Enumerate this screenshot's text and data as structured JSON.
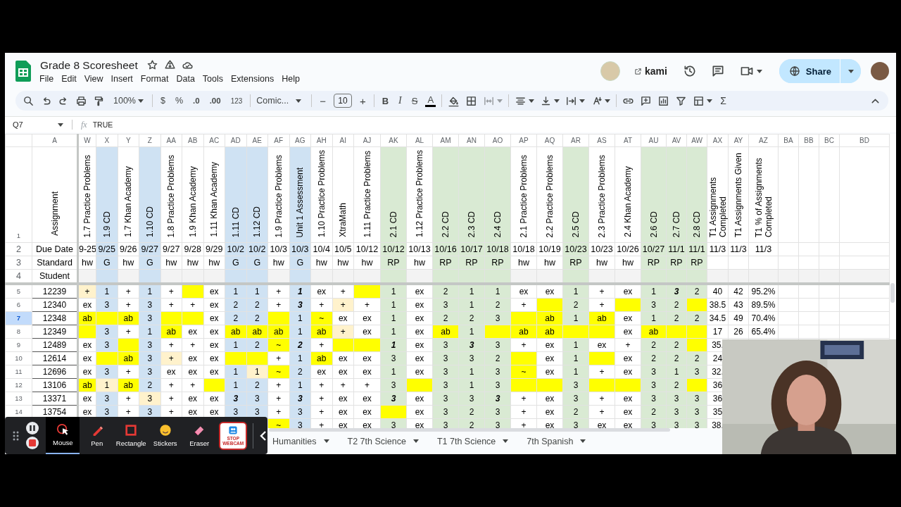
{
  "app": {
    "title": "Grade 8 Scoresheet",
    "menu": [
      "File",
      "Edit",
      "View",
      "Insert",
      "Format",
      "Data",
      "Tools",
      "Extensions",
      "Help"
    ],
    "addon": "kami",
    "share": "Share"
  },
  "toolbar": {
    "zoom": "100%",
    "currency": "$",
    "percent": "%",
    "decrease_decimal": ".0",
    "increase_decimal": ".00",
    "number_format": "123",
    "font": "Comic...",
    "minus": "−",
    "font_size": "10",
    "plus": "+",
    "bold": "B",
    "italic": "I",
    "strikethrough": "S",
    "text_color": "A",
    "sum": "Σ"
  },
  "formula_bar": {
    "cell": "Q7",
    "fx": "fx",
    "value": "TRUE"
  },
  "sheet": {
    "label_column": {
      "letter": "A",
      "title": "Assignment",
      "due": "Due Date",
      "standard": "Standard",
      "student": "Student"
    },
    "header_row_numbers": [
      "1",
      "2",
      "3",
      "4"
    ],
    "columns": [
      {
        "letter": "W",
        "title": "1.7 Practice Problems",
        "due": "9-25",
        "standard": "hw"
      },
      {
        "letter": "X",
        "title": "1.9 CD",
        "due": "9/25",
        "standard": "G",
        "color": "#cfe2f3"
      },
      {
        "letter": "Y",
        "title": "1.7 Khan Academy",
        "due": "9/26",
        "standard": "hw"
      },
      {
        "letter": "Z",
        "title": "1.10 CD",
        "due": "9/27",
        "standard": "G",
        "color": "#cfe2f3"
      },
      {
        "letter": "AA",
        "title": "1.8 Practice Problems",
        "due": "9/27",
        "standard": "hw"
      },
      {
        "letter": "AB",
        "title": "1.9 Khan Academy",
        "due": "9/28",
        "standard": "hw"
      },
      {
        "letter": "AC",
        "title": "1.11 Khan Academy",
        "due": "9/29",
        "standard": "hw"
      },
      {
        "letter": "AD",
        "title": "1.11 CD",
        "due": "10/2",
        "standard": "G",
        "color": "#cfe2f3"
      },
      {
        "letter": "AE",
        "title": "1.12 CD",
        "due": "10/2",
        "standard": "G",
        "color": "#cfe2f3"
      },
      {
        "letter": "AF",
        "title": "1.9 Practice Problems",
        "due": "10/3",
        "standard": "hw"
      },
      {
        "letter": "AG",
        "title": "Unit 1 Assessment",
        "due": "10/3",
        "standard": "G",
        "color": "#cfe2f3"
      },
      {
        "letter": "AH",
        "title": "1.10 Practice Problems",
        "due": "10/4",
        "standard": "hw"
      },
      {
        "letter": "AI",
        "title": "XtraMath",
        "due": "10/5",
        "standard": "hw"
      },
      {
        "letter": "AJ",
        "title": "1.11 Practice Problems",
        "due": "10/12",
        "standard": "hw"
      },
      {
        "letter": "AK",
        "title": "2.1 CD",
        "due": "10/12",
        "standard": "RP",
        "color": "#d9ead3"
      },
      {
        "letter": "AL",
        "title": "1.12 Practice Problems",
        "due": "10/13",
        "standard": "hw"
      },
      {
        "letter": "AM",
        "title": "2.2 CD",
        "due": "10/16",
        "standard": "RP",
        "color": "#d9ead3"
      },
      {
        "letter": "AN",
        "title": "2.3 CD",
        "due": "10/17",
        "standard": "RP",
        "color": "#d9ead3"
      },
      {
        "letter": "AO",
        "title": "2.4 CD",
        "due": "10/18",
        "standard": "RP",
        "color": "#d9ead3"
      },
      {
        "letter": "AP",
        "title": "2.1 Practice Problems",
        "due": "10/18",
        "standard": "hw"
      },
      {
        "letter": "AQ",
        "title": "2.2 Practice Problems",
        "due": "10/19",
        "standard": "hw"
      },
      {
        "letter": "AR",
        "title": "2.5 CD",
        "due": "10/23",
        "standard": "RP",
        "color": "#d9ead3"
      },
      {
        "letter": "AS",
        "title": "2.3 Practice Problems",
        "due": "10/23",
        "standard": "hw"
      },
      {
        "letter": "AT",
        "title": "2.4 Khan Academy",
        "due": "10/26",
        "standard": "hw"
      },
      {
        "letter": "AU",
        "title": "2.6 CD",
        "due": "10/27",
        "standard": "RP",
        "color": "#d9ead3"
      },
      {
        "letter": "AV",
        "title": "2.7 CD",
        "due": "11/1",
        "standard": "RP",
        "color": "#d9ead3"
      },
      {
        "letter": "AW",
        "title": "2.8 CD",
        "due": "11/1",
        "standard": "RP",
        "color": "#d9ead3"
      },
      {
        "letter": "AX",
        "title": "T1 Assignments Completed",
        "due": "11/3"
      },
      {
        "letter": "AY",
        "title": "T1 Assignments Given",
        "due": "11/3"
      },
      {
        "letter": "AZ",
        "title": "T1 % of Assignments Completed",
        "due": "11/3"
      },
      {
        "letter": "BA"
      },
      {
        "letter": "BB"
      },
      {
        "letter": "BC"
      },
      {
        "letter": "BD"
      }
    ],
    "rows": [
      {
        "number": "5",
        "student": "12239",
        "selected": false,
        "cells": [
          {
            "text": "+",
            "color": "#fff2cc"
          },
          "1",
          "+",
          "1",
          "+",
          {
            "color": "#ffff00"
          },
          "ex",
          "1",
          "1",
          "+",
          {
            "text": "1",
            "emphasis": true
          },
          "ex",
          "+",
          {
            "color": "#ffff00"
          },
          "1",
          "ex",
          "2",
          "1",
          "1",
          "ex",
          "ex",
          "1",
          "+",
          "ex",
          "1",
          {
            "text": "3",
            "emphasis": true
          },
          "2",
          "40",
          "42",
          "95.2%"
        ]
      },
      {
        "number": "6",
        "student": "12340",
        "selected": false,
        "cells": [
          "ex",
          "3",
          "+",
          "3",
          "+",
          "+",
          "ex",
          "2",
          "2",
          "+",
          {
            "text": "3",
            "emphasis": true
          },
          "+",
          {
            "text": "+",
            "color": "#fff2cc"
          },
          "+",
          "1",
          "ex",
          "3",
          "1",
          "2",
          "+",
          {
            "color": "#ffff00"
          },
          "2",
          "+",
          {
            "color": "#ffff00"
          },
          "3",
          "2",
          {
            "color": "#ffff00"
          },
          "38.5",
          "43",
          "89.5%"
        ]
      },
      {
        "number": "7",
        "student": "12348",
        "selected": true,
        "cells": [
          {
            "text": "ab",
            "color": "#ffff00"
          },
          {
            "color": "#ffff00"
          },
          {
            "text": "ab",
            "color": "#ffff00"
          },
          "3",
          {
            "color": "#ffff00"
          },
          {
            "color": "#ffff00"
          },
          "ex",
          "2",
          "2",
          {
            "color": "#ffff00"
          },
          "1",
          {
            "text": "~",
            "color": "#ffff00"
          },
          "ex",
          "ex",
          "1",
          "ex",
          "2",
          "2",
          "3",
          {
            "color": "#ffff00"
          },
          {
            "text": "ab",
            "color": "#ffff00"
          },
          "1",
          {
            "text": "ab",
            "color": "#ffff00"
          },
          "ex",
          "1",
          "2",
          "2",
          "34.5",
          "49",
          "70.4%"
        ]
      },
      {
        "number": "8",
        "student": "12349",
        "selected": false,
        "cells": [
          {
            "color": "#ffff00"
          },
          "3",
          "+",
          "1",
          {
            "text": "ab",
            "color": "#ffff00"
          },
          "ex",
          "ex",
          {
            "text": "ab",
            "color": "#ffff00"
          },
          {
            "text": "ab",
            "color": "#ffff00"
          },
          {
            "text": "ab",
            "color": "#ffff00"
          },
          "1",
          {
            "text": "ab",
            "color": "#ffff00"
          },
          {
            "text": "+",
            "color": "#fff2cc"
          },
          "ex",
          "1",
          "ex",
          {
            "text": "ab",
            "color": "#ffff00"
          },
          "1",
          {
            "color": "#ffff00"
          },
          {
            "text": "ab",
            "color": "#ffff00"
          },
          {
            "text": "ab",
            "color": "#ffff00"
          },
          {
            "color": "#ffff00"
          },
          {
            "color": "#ffff00"
          },
          "ex",
          {
            "text": "ab",
            "color": "#ffff00"
          },
          {
            "color": "#ffff00"
          },
          {
            "color": "#ffff00"
          },
          "17",
          "26",
          "65.4%"
        ]
      },
      {
        "number": "9",
        "student": "12489",
        "selected": false,
        "cells": [
          "ex",
          "3",
          {
            "color": "#ffff00"
          },
          "3",
          "+",
          "+",
          "ex",
          "1",
          "2",
          {
            "text": "~",
            "color": "#ffff00"
          },
          {
            "text": "2",
            "emphasis": true
          },
          "+",
          {
            "color": "#ffff00"
          },
          {
            "color": "#ffff00"
          },
          {
            "text": "1",
            "emphasis": true
          },
          "ex",
          "3",
          {
            "text": "3",
            "emphasis": true
          },
          "3",
          "+",
          "ex",
          "1",
          "ex",
          "+",
          "2",
          "2",
          {
            "color": "#ffff00"
          },
          "35."
        ]
      },
      {
        "number": "10",
        "student": "12614",
        "selected": false,
        "cells": [
          "ex",
          {
            "color": "#ffff00"
          },
          {
            "text": "ab",
            "color": "#ffff00"
          },
          "3",
          {
            "text": "+",
            "color": "#fff2cc"
          },
          "ex",
          "ex",
          {
            "color": "#ffff00"
          },
          {
            "color": "#ffff00"
          },
          "+",
          "1",
          {
            "text": "ab",
            "color": "#ffff00"
          },
          "ex",
          "ex",
          "3",
          "ex",
          "3",
          "3",
          "2",
          {
            "color": "#ffff00"
          },
          "ex",
          "1",
          {
            "color": "#ffff00"
          },
          "ex",
          "2",
          "2",
          "2",
          "24"
        ]
      },
      {
        "number": "11",
        "student": "12696",
        "selected": false,
        "cells": [
          "ex",
          "3",
          "+",
          "3",
          "ex",
          "ex",
          "ex",
          "1",
          {
            "text": "1",
            "color": "#fff2cc"
          },
          {
            "text": "~",
            "color": "#ffff00"
          },
          "2",
          "ex",
          "ex",
          "ex",
          "1",
          "ex",
          "3",
          "1",
          "3",
          {
            "text": "~",
            "color": "#ffff00"
          },
          "ex",
          "1",
          "+",
          "ex",
          "3",
          "1",
          "3",
          "32."
        ]
      },
      {
        "number": "12",
        "student": "13106",
        "selected": false,
        "cells": [
          {
            "text": "ab",
            "color": "#ffff00"
          },
          {
            "text": "1",
            "color": "#fff2cc"
          },
          {
            "text": "ab",
            "color": "#ffff00"
          },
          "2",
          "+",
          "+",
          {
            "color": "#ffff00"
          },
          "1",
          "2",
          "+",
          "1",
          "+",
          "+",
          "+",
          "3",
          {
            "color": "#ffff00"
          },
          "3",
          "1",
          "3",
          {
            "color": "#ffff00"
          },
          {
            "color": "#ffff00"
          },
          "3",
          {
            "color": "#ffff00"
          },
          {
            "color": "#ffff00"
          },
          "3",
          "2",
          {
            "color": "#ffff00"
          },
          "36"
        ]
      },
      {
        "number": "13",
        "student": "13371",
        "selected": false,
        "cells": [
          "ex",
          "3",
          "+",
          {
            "text": "3",
            "color": "#fff2cc"
          },
          "+",
          "ex",
          "ex",
          {
            "text": "3",
            "emphasis": true
          },
          "3",
          "+",
          {
            "text": "3",
            "emphasis": true
          },
          "+",
          "ex",
          "ex",
          {
            "text": "3",
            "emphasis": true
          },
          "ex",
          "3",
          "3",
          {
            "text": "3",
            "emphasis": true
          },
          "+",
          "ex",
          "3",
          "+",
          "ex",
          "3",
          "3",
          "3",
          "36"
        ]
      },
      {
        "number": "14",
        "student": "13754",
        "selected": false,
        "cells": [
          "ex",
          "3",
          "+",
          "3",
          "+",
          "ex",
          "ex",
          "3",
          "3",
          "+",
          "3",
          "+",
          "ex",
          "ex",
          {
            "color": "#ffff00"
          },
          "ex",
          "3",
          "2",
          "3",
          "+",
          "ex",
          "2",
          "+",
          "ex",
          "2",
          "3",
          "3",
          "35"
        ]
      },
      {
        "cells": [
          "",
          "",
          "",
          "",
          "",
          "",
          "",
          "",
          "",
          {
            "text": "~",
            "color": "#ffff00"
          },
          "3",
          "+",
          "ex",
          "ex",
          "3",
          "ex",
          "3",
          "2",
          "3",
          "+",
          "ex",
          "3",
          "ex",
          "ex",
          "3",
          "3",
          "3",
          "38."
        ]
      }
    ]
  },
  "sheet_tabs": [
    "Humanities",
    "T2 7th Science",
    "T1 7th Science",
    "7th Spanish"
  ],
  "recorder": {
    "tools": [
      {
        "kind": "mouse",
        "label": "Mouse",
        "selected": true
      },
      {
        "kind": "pen",
        "label": "Pen",
        "selected": false
      },
      {
        "kind": "rectangle",
        "label": "Rectangle",
        "selected": false
      },
      {
        "kind": "stickers",
        "label": "Stickers",
        "selected": false
      },
      {
        "kind": "eraser",
        "label": "Eraser",
        "selected": false
      },
      {
        "kind": "webcam",
        "label": "STOP WEBCAM",
        "selected": false
      }
    ]
  }
}
